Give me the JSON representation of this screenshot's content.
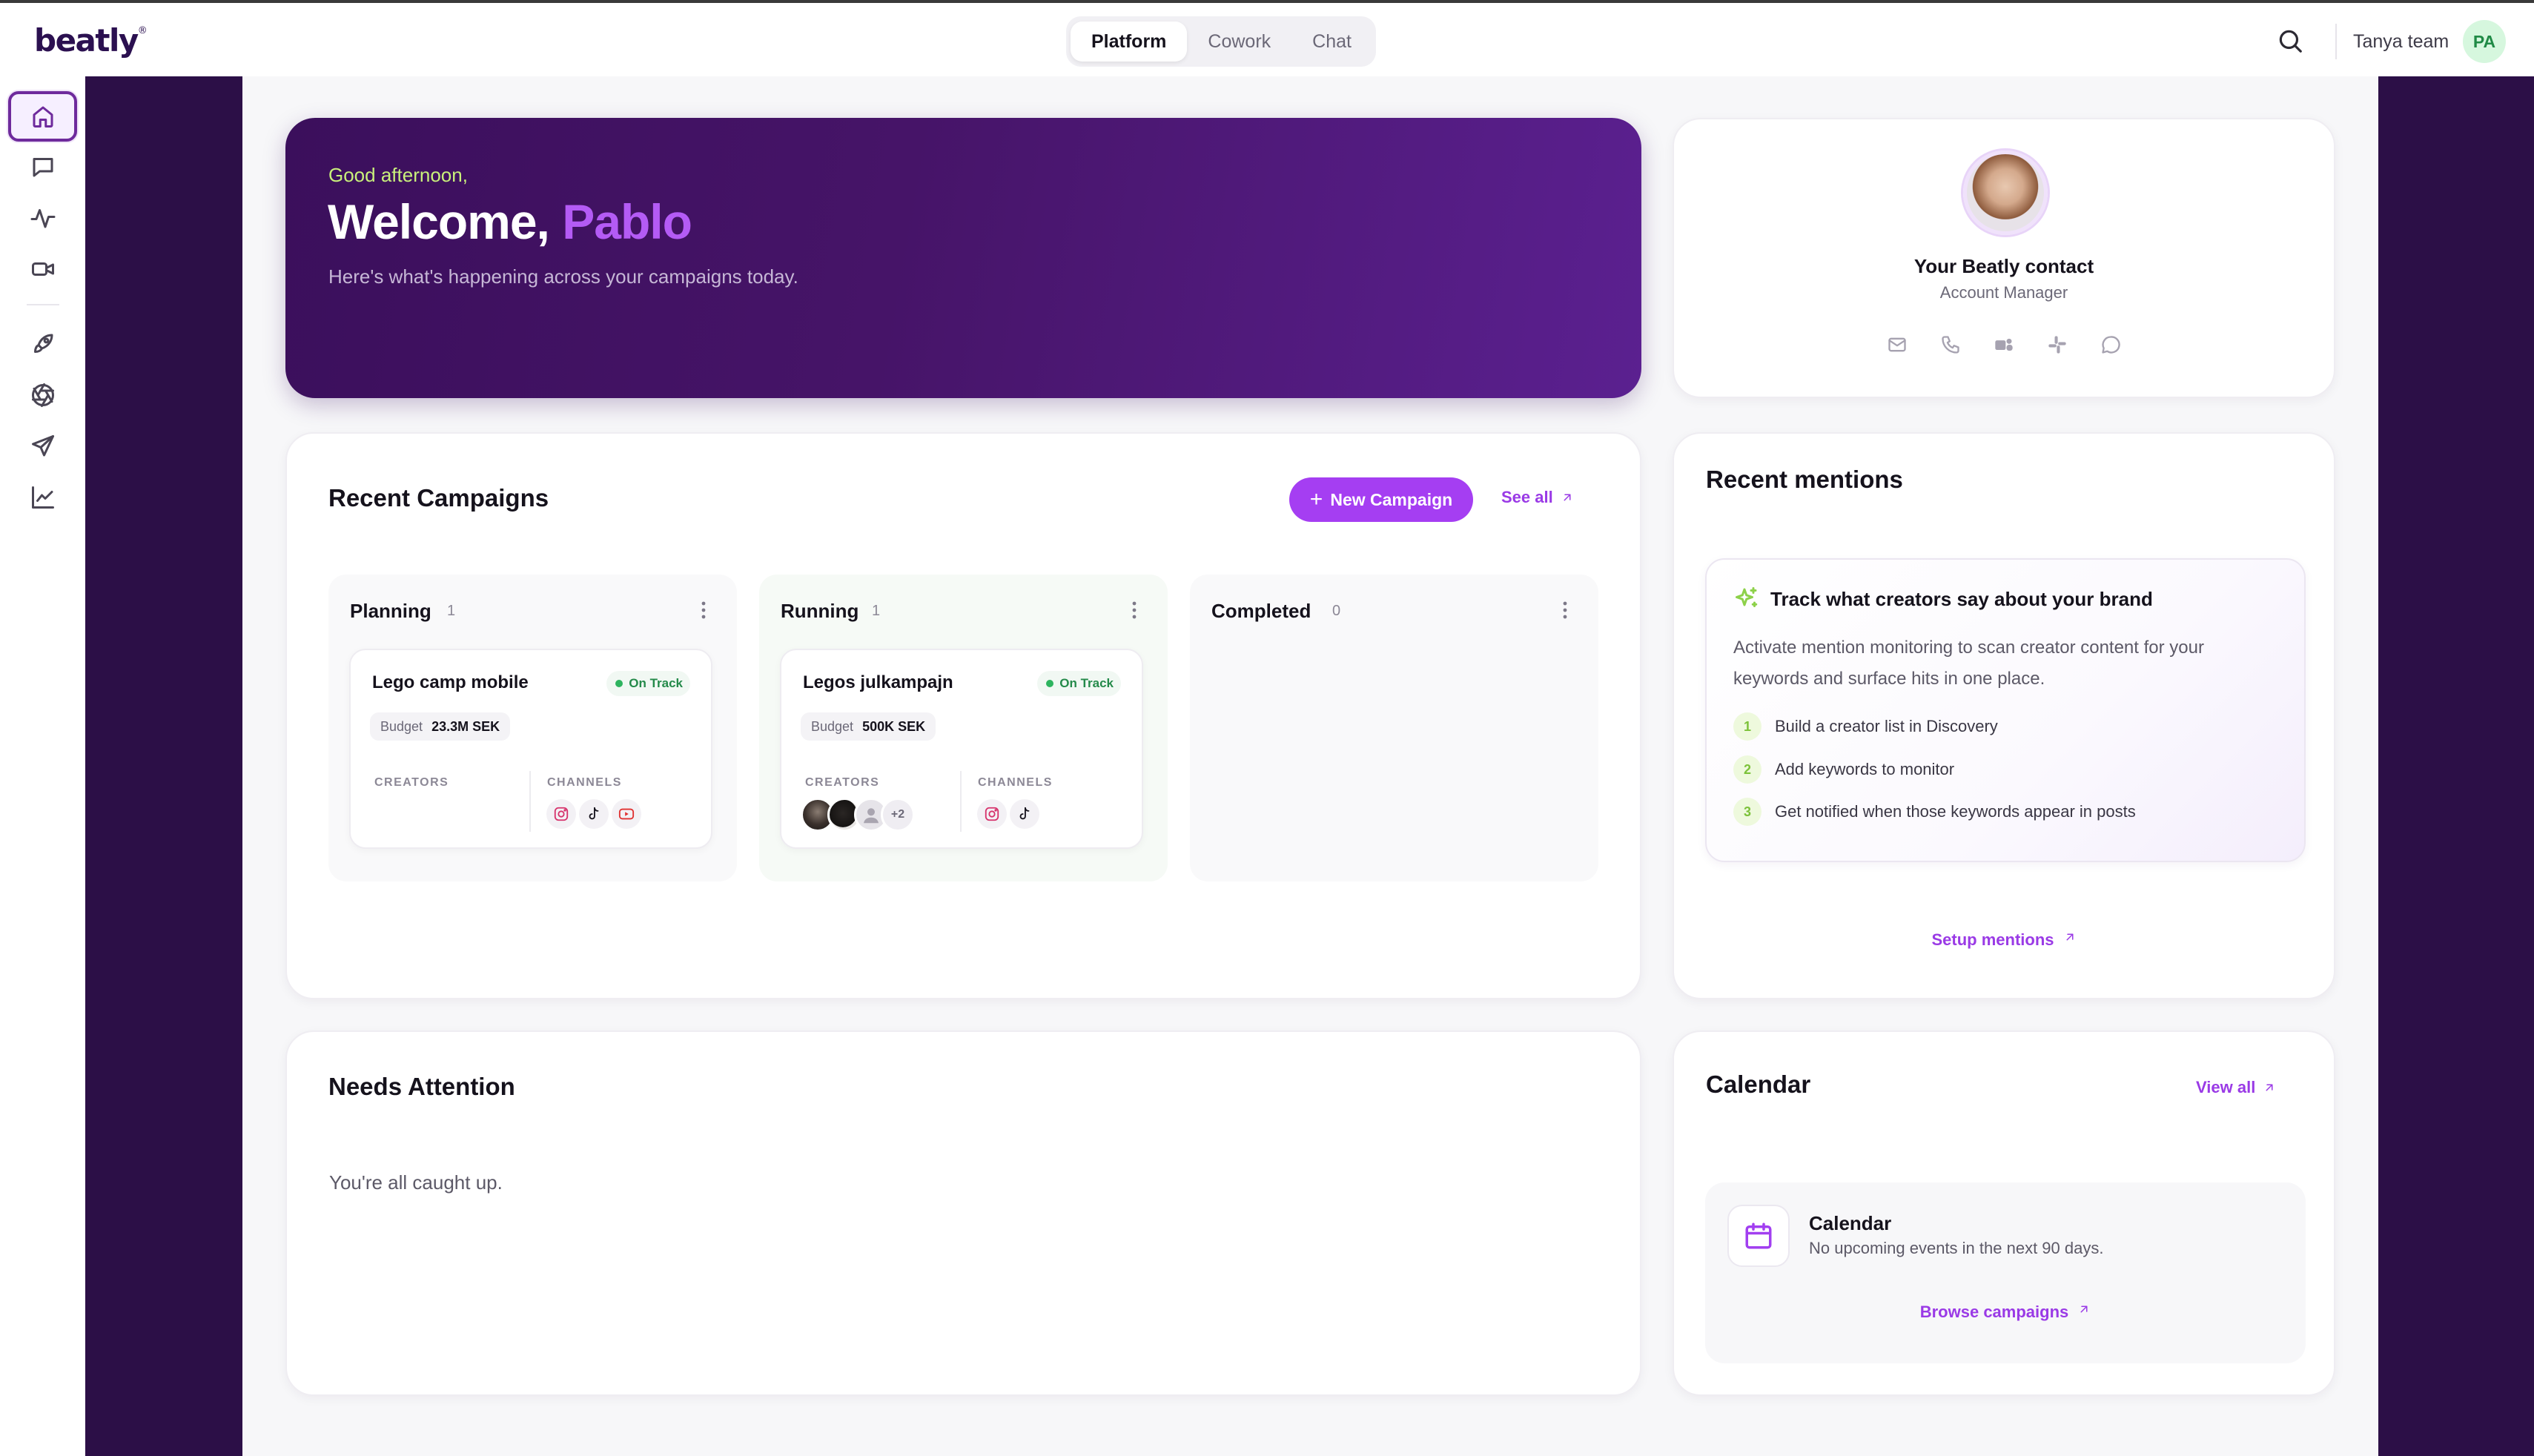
{
  "app": {
    "logo": "beatly",
    "logo_mark": "®"
  },
  "topbar": {
    "tabs": [
      {
        "label": "Platform",
        "active": true
      },
      {
        "label": "Cowork",
        "active": false
      },
      {
        "label": "Chat",
        "active": false
      }
    ],
    "team_name": "Tanya team",
    "user_initials": "PA"
  },
  "siderail": {
    "items": [
      {
        "icon": "home-icon",
        "active": true
      },
      {
        "icon": "message-icon",
        "active": false
      },
      {
        "icon": "activity-icon",
        "active": false
      },
      {
        "icon": "video-icon",
        "active": false
      },
      {
        "icon": "rocket-icon",
        "active": false
      },
      {
        "icon": "aperture-icon",
        "active": false
      },
      {
        "icon": "send-icon",
        "active": false
      },
      {
        "icon": "line-chart-icon",
        "active": false
      }
    ]
  },
  "hero": {
    "greeting": "Good afternoon,",
    "welcome": "Welcome,",
    "name": "Pablo",
    "subtitle": "Here's what's happening across your campaigns today."
  },
  "contact": {
    "title": "Your Beatly contact",
    "role": "Account Manager",
    "actions": [
      "mail-icon",
      "phone-icon",
      "teams-icon",
      "slack-icon",
      "chat-bubble-icon"
    ]
  },
  "campaigns": {
    "title": "Recent Campaigns",
    "new_button": "New Campaign",
    "see_all": "See all",
    "columns": [
      {
        "name": "Planning",
        "count": "1",
        "card": {
          "name": "Lego camp mobile",
          "status": "On Track",
          "budget_label": "Budget",
          "budget_value": "23.3M SEK",
          "creators_label": "CREATORS",
          "channels_label": "CHANNELS",
          "channels": [
            "instagram-icon",
            "tiktok-icon",
            "youtube-icon"
          ]
        }
      },
      {
        "name": "Running",
        "count": "1",
        "card": {
          "name": "Legos julkampajn",
          "status": "On Track",
          "budget_label": "Budget",
          "budget_value": "500K SEK",
          "creators_label": "CREATORS",
          "channels_label": "CHANNELS",
          "creators_more": "+2",
          "channels": [
            "instagram-icon",
            "tiktok-icon"
          ]
        }
      },
      {
        "name": "Completed",
        "count": "0"
      }
    ]
  },
  "mentions": {
    "title": "Recent mentions",
    "heading": "Track what creators say about your brand",
    "description": "Activate mention monitoring to scan creator content for your keywords and surface hits in one place.",
    "steps": [
      {
        "num": "1",
        "text": "Build a creator list in Discovery"
      },
      {
        "num": "2",
        "text": "Add keywords to monitor"
      },
      {
        "num": "3",
        "text": "Get notified when those keywords appear in posts"
      }
    ],
    "setup_link": "Setup mentions"
  },
  "attention": {
    "title": "Needs Attention",
    "empty": "You're all caught up."
  },
  "calendar": {
    "title": "Calendar",
    "view_all": "View all",
    "box_title": "Calendar",
    "box_sub": "No upcoming events in the next 90 days.",
    "browse_link": "Browse campaigns"
  },
  "colors": {
    "brand_dark": "#2c0f47",
    "accent_purple": "#a53ef2",
    "link_purple": "#9a3ae6",
    "status_green": "#2eb45f",
    "greeting_lime": "#c9f07b"
  }
}
